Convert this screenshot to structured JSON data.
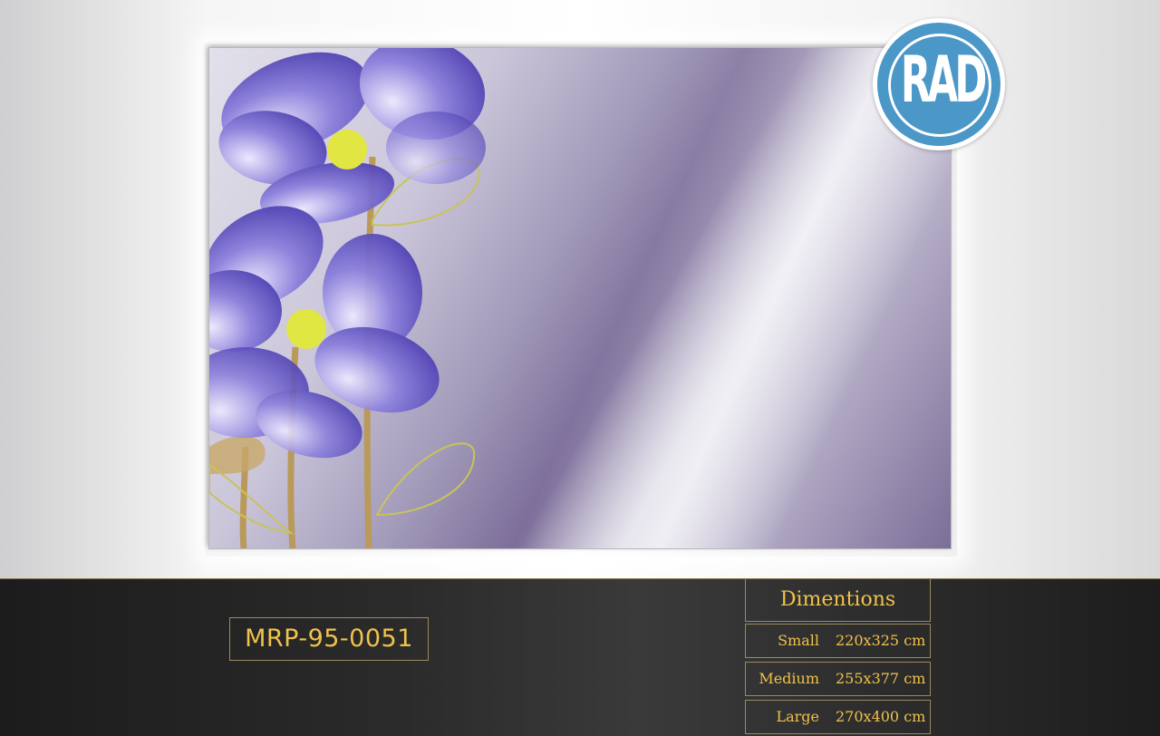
{
  "product": {
    "code": "MRP-95-0051"
  },
  "logo": {
    "text": "RAD",
    "colors": {
      "ring": "#4a97c8",
      "text": "#ffffff"
    }
  },
  "artwork": {
    "colors": {
      "background": "#9f97b8",
      "petal": "#6a5fc4",
      "stamen": "#e2e83a",
      "stem": "#b99a5a"
    }
  },
  "dimensions": {
    "title": "Dimentions",
    "sizes": [
      {
        "name": "Small",
        "value": "220x325 cm"
      },
      {
        "name": "Medium",
        "value": "255x377 cm"
      },
      {
        "name": "Large",
        "value": "270x400 cm"
      }
    ]
  },
  "colors": {
    "accent": "#f0c24a",
    "bar": "#2b2b2b",
    "border": "#9a8a5c"
  }
}
